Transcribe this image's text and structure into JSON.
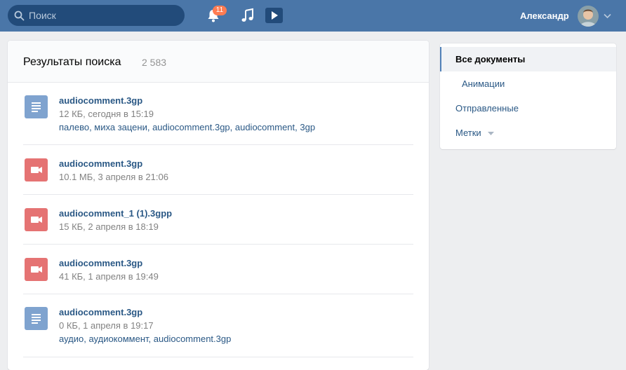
{
  "header": {
    "search_placeholder": "Поиск",
    "notifications_count": "11",
    "user_name": "Александр",
    "icons": [
      "search-icon",
      "bell-icon",
      "music-icon",
      "video-icon",
      "chevron-down-icon"
    ]
  },
  "results": {
    "title": "Результаты поиска",
    "count": "2 583",
    "items": [
      {
        "name": "audiocomment.3gp",
        "meta": "12 КБ, сегодня в 15:19",
        "tags": "палево, миха зацени, audiocomment.3gp, audiocomment, 3gp",
        "type": "document"
      },
      {
        "name": "audiocomment.3gp",
        "meta": "10.1 МБ, 3 апреля в 21:06",
        "tags": "",
        "type": "video"
      },
      {
        "name": "audiocomment_1 (1).3gpp",
        "meta": "15 КБ, 2 апреля в 18:19",
        "tags": "",
        "type": "video"
      },
      {
        "name": "audiocomment.3gp",
        "meta": "41 КБ, 1 апреля в 19:49",
        "tags": "",
        "type": "video"
      },
      {
        "name": "audiocomment.3gp",
        "meta": "0 КБ, 1 апреля в 19:17",
        "tags": "аудио, аудиокоммент, audiocomment.3gp",
        "type": "document"
      }
    ]
  },
  "sidebar": {
    "items": [
      {
        "label": "Все документы",
        "active": true
      },
      {
        "label": "Анимации"
      },
      {
        "label": "Отправленные"
      },
      {
        "label": "Метки"
      }
    ]
  },
  "colors": {
    "header_bg": "#4a76a8",
    "link": "#2a5885",
    "badge": "#ff7c52",
    "doc_icon": "#7fa3cf",
    "video_icon": "#e57373"
  }
}
